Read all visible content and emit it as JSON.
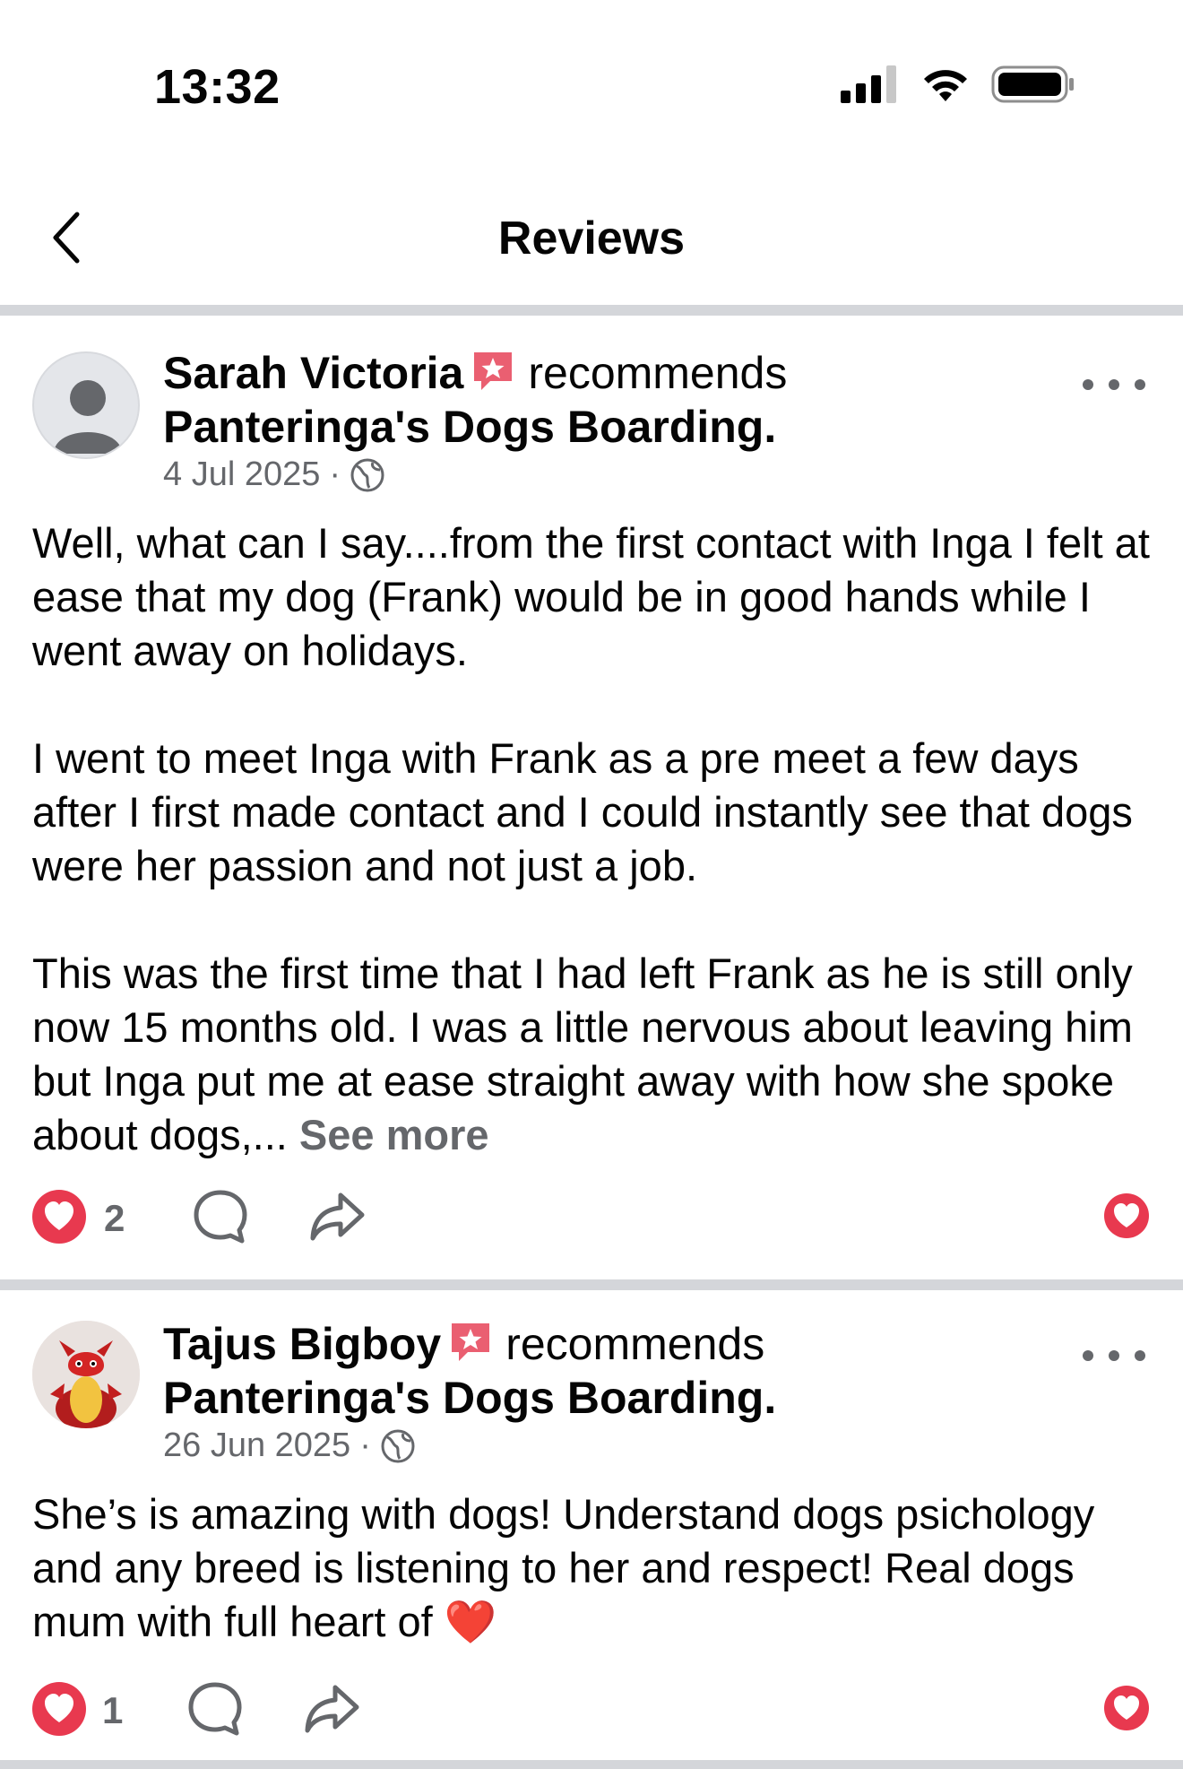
{
  "status_bar": {
    "time": "13:32",
    "icons": [
      "cellular-signal-icon",
      "wifi-icon",
      "battery-icon"
    ]
  },
  "header": {
    "title": "Reviews",
    "back_icon": "chevron-left-icon"
  },
  "reviews": [
    {
      "author": "Sarah Victoria",
      "action": "recommends",
      "business": "Panteringa's Dogs Boarding.",
      "date": "4 Jul 2025",
      "separator": "·",
      "paragraphs": [
        "Well, what can I say....from the first contact with Inga I felt at ease that my dog (Frank) would be in good hands while I went away on holidays.",
        "I went to meet Inga with Frank as a pre meet a few days after I first made contact and I could instantly see that dogs were her passion and not just a job.",
        "This was the first time that I had left Frank as he is still only now 15 months old. I was a little nervous about leaving him but Inga put me at ease straight away with how she spoke about dogs,..."
      ],
      "see_more": "See more",
      "like_count": "2"
    },
    {
      "author": "Tajus Bigboy",
      "action": "recommends",
      "business": "Panteringa's Dogs Boarding.",
      "date": "26 Jun 2025",
      "separator": "·",
      "paragraphs": [
        "She’s is amazing with dogs! Understand dogs psichology and any breed is listening to her and respect! Real dogs mum with full heart of ❤️"
      ],
      "like_count": "1"
    }
  ],
  "colors": {
    "like_red": "#e8394f",
    "secondary_text": "#65676b",
    "separator": "#d4d6da"
  }
}
